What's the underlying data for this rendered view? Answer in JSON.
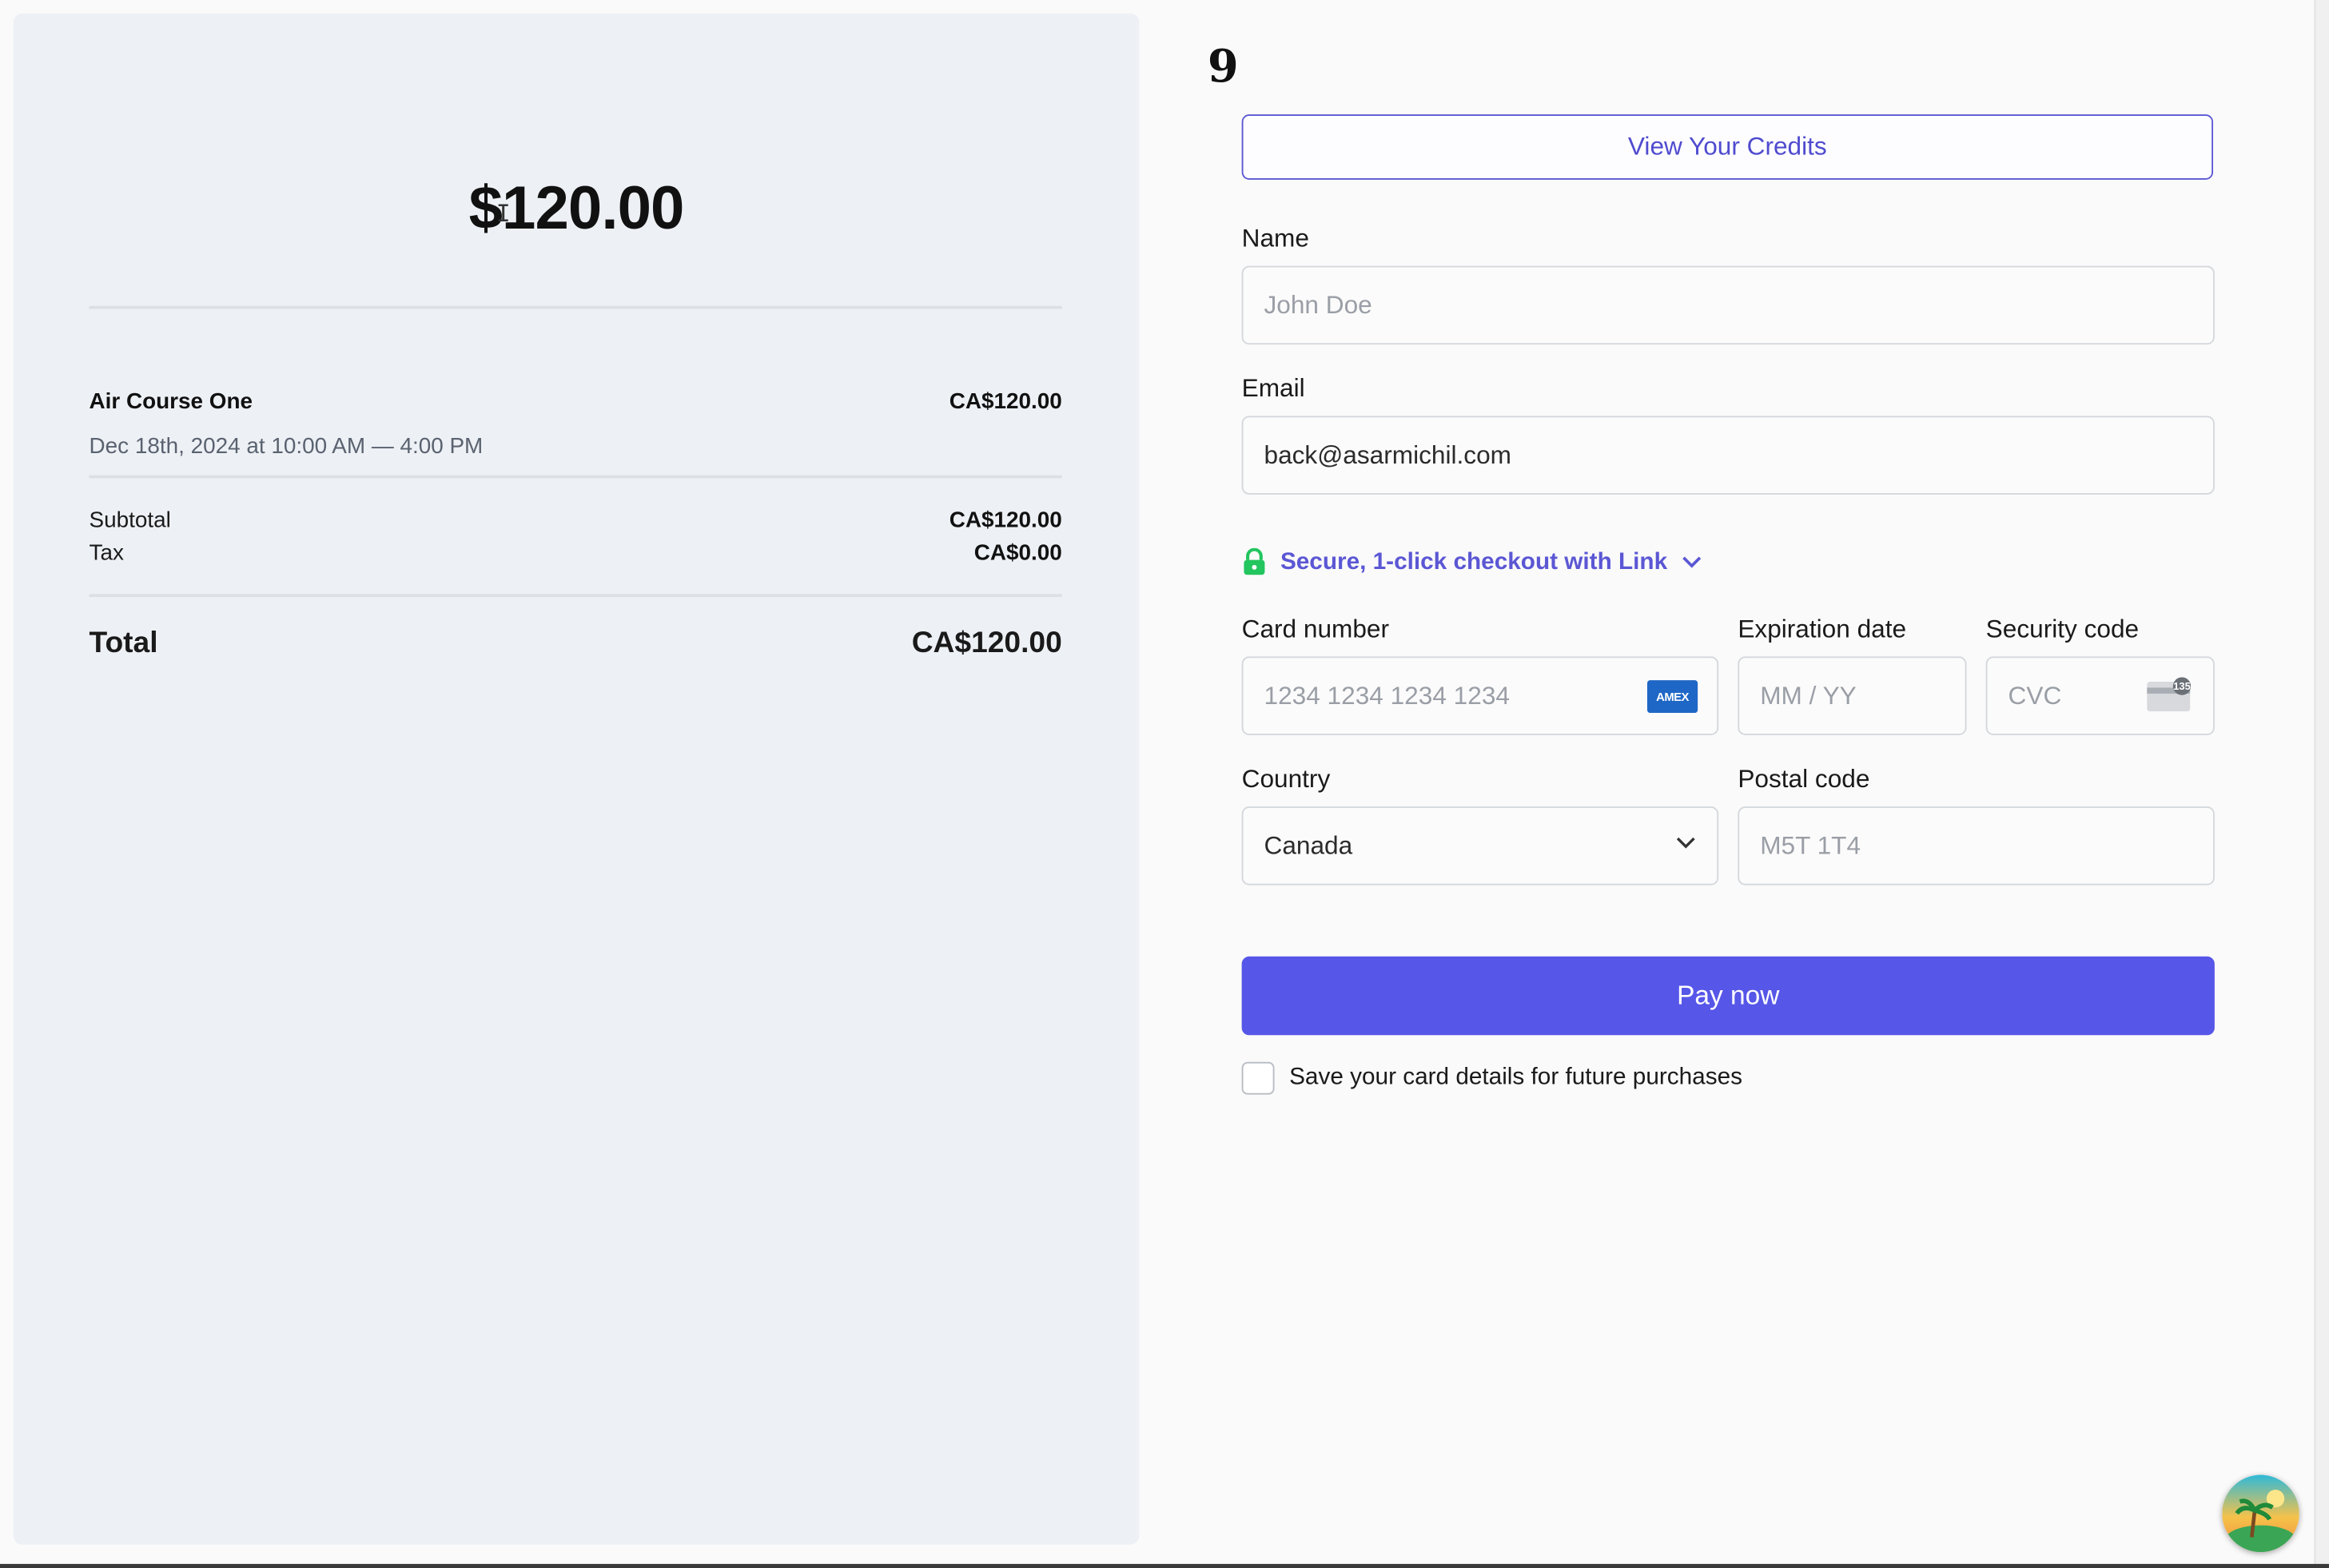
{
  "summary": {
    "amount": "$120.00",
    "item": {
      "name": "Air Course One",
      "date": "Dec 18th, 2024 at 10:00 AM — 4:00 PM",
      "price": "CA$120.00"
    },
    "subtotal_label": "Subtotal",
    "subtotal_value": "CA$120.00",
    "tax_label": "Tax",
    "tax_value": "CA$0.00",
    "total_label": "Total",
    "total_value": "CA$120.00",
    "cursor_glyph": "I"
  },
  "logo_text": "9",
  "credits_button": "View Your Credits",
  "form": {
    "name_label": "Name",
    "name_placeholder": "John Doe",
    "email_label": "Email",
    "email_value": "back@asarmichil.com",
    "link_text": "Secure, 1-click checkout with Link",
    "card_label": "Card number",
    "card_placeholder": "1234 1234 1234 1234",
    "card_brand": "AMEX",
    "exp_label": "Expiration date",
    "exp_placeholder": "MM / YY",
    "cvc_label": "Security code",
    "cvc_placeholder": "CVC",
    "cvc_badge": "135",
    "country_label": "Country",
    "country_value": "Canada",
    "postal_label": "Postal code",
    "postal_placeholder": "M5T 1T4",
    "pay_button": "Pay now",
    "save_card_label": "Save your card details for future purchases"
  },
  "colors": {
    "accent": "#5656e8",
    "link": "#5b57d4",
    "lock": "#22c55e",
    "summary_bg": "#edf1f5"
  },
  "icons": [
    "text-cursor-icon",
    "lock-icon",
    "chevron-down-icon",
    "amex-card-icon",
    "cvc-card-icon",
    "avatar-icon"
  ]
}
